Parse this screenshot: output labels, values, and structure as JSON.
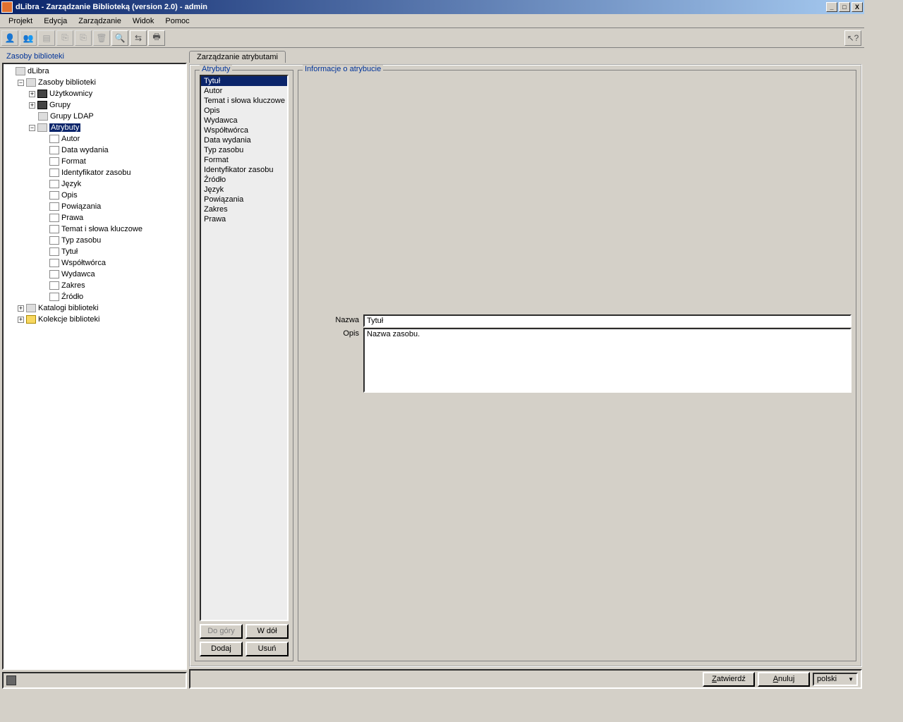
{
  "window": {
    "title": "dLibra - Zarządzanie Biblioteką (version 2.0) - admin"
  },
  "menu": {
    "projekt": "Projekt",
    "edycja": "Edycja",
    "zarzadzanie": "Zarządzanie",
    "widok": "Widok",
    "pomoc": "Pomoc"
  },
  "left_panel": {
    "title": "Zasoby biblioteki"
  },
  "tree": {
    "root": "dLibra",
    "zasoby": "Zasoby biblioteki",
    "uzytkownicy": "Użytkownicy",
    "grupy": "Grupy",
    "grupy_ldap": "Grupy LDAP",
    "atrybuty": "Atrybuty",
    "attr_children": [
      "Autor",
      "Data wydania",
      "Format",
      "Identyfikator zasobu",
      "Język",
      "Opis",
      "Powiązania",
      "Prawa",
      "Temat i słowa kluczowe",
      "Typ zasobu",
      "Tytuł",
      "Współtwórca",
      "Wydawca",
      "Zakres",
      "Źródło"
    ],
    "katalogi": "Katalogi biblioteki",
    "kolekcje": "Kolekcje biblioteki"
  },
  "tab": {
    "label": "Zarządzanie atrybutami"
  },
  "attr_fieldset": {
    "legend": "Atrybuty",
    "items": [
      "Tytuł",
      "Autor",
      "Temat i słowa kluczowe",
      "Opis",
      "Wydawca",
      "Współtwórca",
      "Data wydania",
      "Typ zasobu",
      "Format",
      "Identyfikator zasobu",
      "Źródło",
      "Język",
      "Powiązania",
      "Zakres",
      "Prawa"
    ],
    "btn_up": "Do góry",
    "btn_down": "W dół",
    "btn_add": "Dodaj",
    "btn_del": "Usuń"
  },
  "info_fieldset": {
    "legend": "Informacje o atrybucie",
    "label_name": "Nazwa",
    "value_name": "Tytuł",
    "label_desc": "Opis",
    "value_desc": "Nazwa zasobu."
  },
  "footer": {
    "confirm": "Zatwierdź",
    "cancel": "Anuluj",
    "lang": "polski"
  }
}
